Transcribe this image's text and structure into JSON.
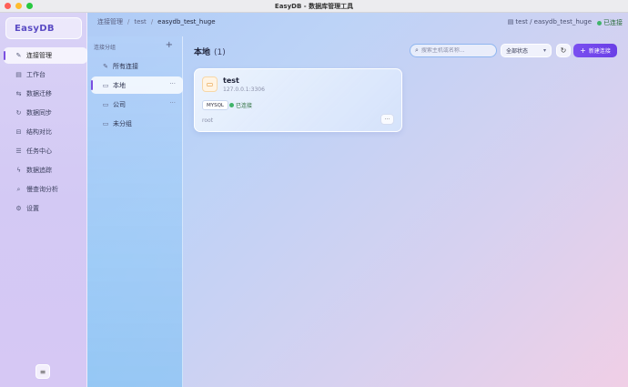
{
  "window": {
    "title": "EasyDB - 数据库管理工具"
  },
  "sidebar": {
    "brand": "EasyDB",
    "items": [
      {
        "label": "连接管理",
        "icon": "plug-icon",
        "glyph": "✎"
      },
      {
        "label": "工作台",
        "icon": "table-icon",
        "glyph": "▤"
      },
      {
        "label": "数据迁移",
        "icon": "migrate-icon",
        "glyph": "⇆"
      },
      {
        "label": "数据同步",
        "icon": "sync-icon",
        "glyph": "↻"
      },
      {
        "label": "结构对比",
        "icon": "compare-icon",
        "glyph": "⊟"
      },
      {
        "label": "任务中心",
        "icon": "list-icon",
        "glyph": "☰"
      },
      {
        "label": "数据追踪",
        "icon": "bolt-icon",
        "glyph": "ϟ"
      },
      {
        "label": "慢查询分析",
        "icon": "search-icon",
        "glyph": "⌕"
      },
      {
        "label": "设置",
        "icon": "gear-icon",
        "glyph": "⚙"
      }
    ],
    "collapse_glyph": "≡"
  },
  "breadcrumb": {
    "items": [
      "连接管理",
      "test",
      "easydb_test_huge"
    ],
    "sep": "/"
  },
  "header_right": {
    "db_path": "test / easydb_test_huge",
    "status": "已连接"
  },
  "groups": {
    "header": "连接分组",
    "add_glyph": "+",
    "items": [
      {
        "label": "所有连接"
      },
      {
        "label": "本地",
        "more": "···"
      },
      {
        "label": "公司",
        "more": "···"
      },
      {
        "label": "未分组"
      }
    ]
  },
  "main": {
    "title": "本地",
    "count": "(1)",
    "search_placeholder": "搜索主机或名称...",
    "status_filter": "全部状态",
    "new_button": "新建连接",
    "refresh_glyph": "↻"
  },
  "connections": [
    {
      "name": "test",
      "host": "127.0.0.1:3306",
      "type": "MYSQL",
      "state": "已连接",
      "user": "root",
      "more": "···"
    }
  ],
  "colors": {
    "accent": "#7a4ff0",
    "connected": "#3fb46a"
  }
}
